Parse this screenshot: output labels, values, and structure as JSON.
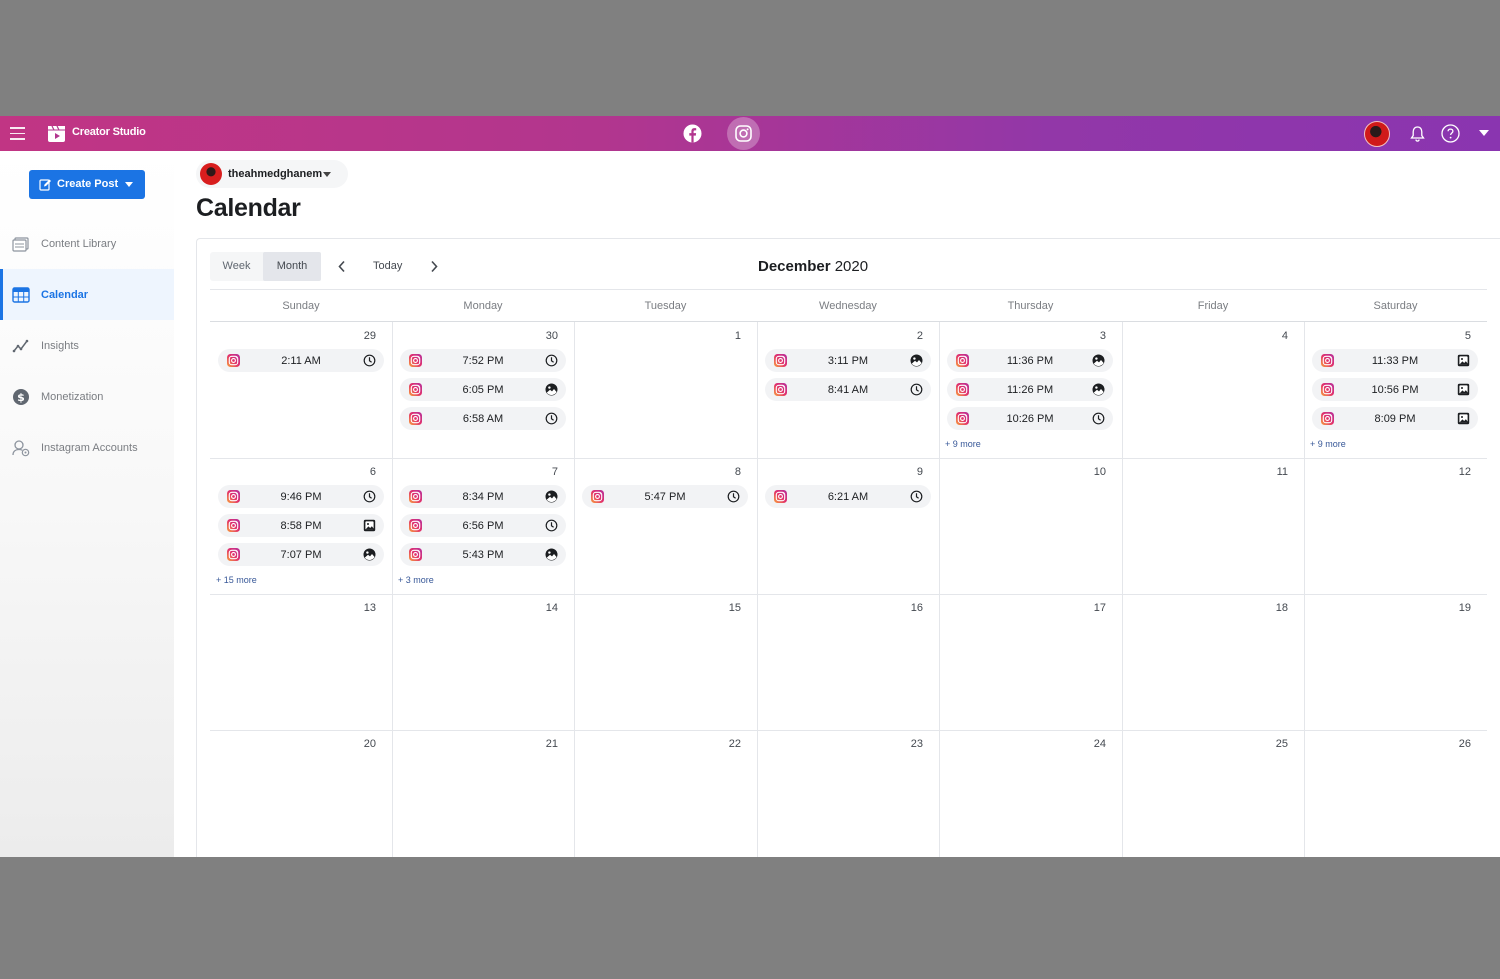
{
  "app": {
    "title": "Creator Studio"
  },
  "account": {
    "name": "theahmedghanem"
  },
  "sidebar": {
    "create_label": "Create Post",
    "items": [
      {
        "label": "Content Library",
        "icon": "content-library-icon"
      },
      {
        "label": "Calendar",
        "icon": "calendar-icon",
        "active": true
      },
      {
        "label": "Insights",
        "icon": "insights-icon"
      },
      {
        "label": "Monetization",
        "icon": "dollar-icon"
      },
      {
        "label": "Instagram Accounts",
        "icon": "instagram-accounts-icon"
      }
    ]
  },
  "page": {
    "title": "Calendar"
  },
  "calendar": {
    "view_week": "Week",
    "view_month": "Month",
    "today": "Today",
    "month_name": "December",
    "year": "2020",
    "days_of_week": [
      "Sunday",
      "Monday",
      "Tuesday",
      "Wednesday",
      "Thursday",
      "Friday",
      "Saturday"
    ],
    "weeks": [
      [
        "29",
        "30",
        "1",
        "2",
        "3",
        "4",
        "5"
      ],
      [
        "6",
        "7",
        "8",
        "9",
        "10",
        "11",
        "12"
      ],
      [
        "13",
        "14",
        "15",
        "16",
        "17",
        "18",
        "19"
      ],
      [
        "20",
        "21",
        "22",
        "23",
        "24",
        "25",
        "26"
      ]
    ],
    "events": {
      "w0d0": [
        {
          "time": "2:11 AM",
          "status": "scheduled"
        }
      ],
      "w0d1": [
        {
          "time": "7:52 PM",
          "status": "scheduled"
        },
        {
          "time": "6:05 PM",
          "status": "published"
        },
        {
          "time": "6:58 AM",
          "status": "scheduled"
        }
      ],
      "w0d3": [
        {
          "time": "3:11 PM",
          "status": "published"
        },
        {
          "time": "8:41 AM",
          "status": "scheduled"
        }
      ],
      "w0d4": [
        {
          "time": "11:36 PM",
          "status": "published"
        },
        {
          "time": "11:26 PM",
          "status": "published"
        },
        {
          "time": "10:26 PM",
          "status": "scheduled"
        }
      ],
      "w0d6": [
        {
          "time": "11:33 PM",
          "status": "photo"
        },
        {
          "time": "10:56 PM",
          "status": "photo"
        },
        {
          "time": "8:09 PM",
          "status": "photo"
        }
      ],
      "w1d0": [
        {
          "time": "9:46 PM",
          "status": "scheduled"
        },
        {
          "time": "8:58 PM",
          "status": "photo"
        },
        {
          "time": "7:07 PM",
          "status": "published"
        }
      ],
      "w1d1": [
        {
          "time": "8:34 PM",
          "status": "published"
        },
        {
          "time": "6:56 PM",
          "status": "scheduled"
        },
        {
          "time": "5:43 PM",
          "status": "published"
        }
      ],
      "w1d2": [
        {
          "time": "5:47 PM",
          "status": "scheduled"
        }
      ],
      "w1d3": [
        {
          "time": "6:21 AM",
          "status": "scheduled"
        }
      ]
    },
    "more": {
      "w0d4": "+ 9 more",
      "w0d6": "+ 9 more",
      "w1d0": "+ 15 more",
      "w1d1": "+ 3 more"
    }
  }
}
